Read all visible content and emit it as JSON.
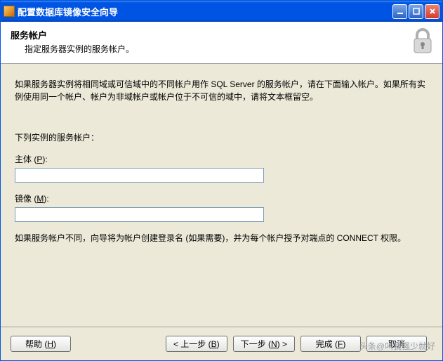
{
  "window": {
    "title": "配置数据库镜像安全向导"
  },
  "header": {
    "title": "服务帐户",
    "subtitle": "指定服务器实例的服务帐户。"
  },
  "content": {
    "description": "如果服务器实例将相同域或可信域中的不同帐户用作 SQL Server 的服务帐户，请在下面输入帐户。如果所有实例使用同一个帐户、帐户为非域帐户或帐户位于不可信的域中，请将文本框留空。",
    "section_label": "下列实例的服务帐户：",
    "principal_label_pre": "主体 (",
    "principal_label_key": "P",
    "principal_label_post": "):",
    "principal_value": "",
    "mirror_label_pre": "镜像 (",
    "mirror_label_key": "M",
    "mirror_label_post": "):",
    "mirror_value": "",
    "note": "如果服务帐户不同，向导将为帐户创建登录名 (如果需要)，并为每个帐户授予对端点的 CONNECT 权限。"
  },
  "buttons": {
    "help_pre": "帮助 (",
    "help_key": "H",
    "help_post": ")",
    "back_pre": "< 上一步 (",
    "back_key": "B",
    "back_post": ")",
    "next_pre": "下一步 (",
    "next_key": "N",
    "next_post": ") >",
    "finish_pre": "完成 (",
    "finish_key": "F",
    "finish_post": ")",
    "cancel": "取消"
  },
  "watermark": "头条@叫我强少就好"
}
